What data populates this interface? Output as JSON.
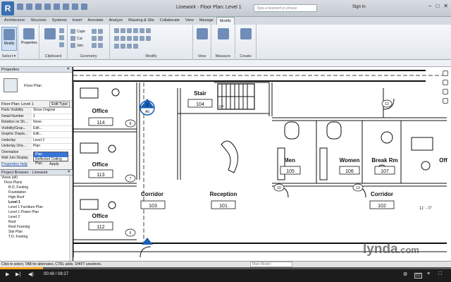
{
  "titlebar": {
    "app_icon": "R",
    "title": "Linework - Floor Plan: Level 1",
    "search_placeholder": "Type a keyword or phrase",
    "signin": "Sign In"
  },
  "tabs": [
    "Architecture",
    "Structure",
    "Systems",
    "Insert",
    "Annotate",
    "Analyze",
    "Massing & Site",
    "Collaborate",
    "View",
    "Manage",
    "Modify"
  ],
  "ribbon": {
    "modify_label": "Modify",
    "groups": [
      "Select ▾",
      "Properties",
      "Clipboard",
      "Geometry",
      "Modify",
      "View",
      "Measure",
      "Create"
    ],
    "geometry_items": [
      "Cope",
      "Cut",
      "Join"
    ],
    "properties_label": "Properties"
  },
  "properties": {
    "header": "Properties",
    "type_name": "Floor Plan",
    "instance": "Floor Plan: Level 1",
    "edit_type": "Edit Type",
    "rows": [
      {
        "k": "Parts Visibility",
        "v": "Show Original"
      },
      {
        "k": "Detail Number",
        "v": "1"
      },
      {
        "k": "Rotation on Sh...",
        "v": "None"
      },
      {
        "k": "Visibility/Grap...",
        "v": "Edit..."
      },
      {
        "k": "Graphic Displa...",
        "v": "Edit..."
      },
      {
        "k": "Underlay",
        "v": "Level 2"
      },
      {
        "k": "Underlay Orie...",
        "v": "Plan"
      },
      {
        "k": "Orientation",
        "v": ""
      },
      {
        "k": "Wall Join Display",
        "v": ""
      }
    ],
    "dropdown_options": [
      "Plan",
      "Reflected Ceiling Plan"
    ],
    "dropdown_selected": "Plan",
    "help": "Properties help",
    "apply": "Apply"
  },
  "browser": {
    "header": "Project Browser - Linework",
    "items": [
      "Views (all)",
      "Floor Plans",
      "B.O. Footing",
      "Foundation",
      "High Roof",
      "Level 1",
      "Level 1 Furniture Plan",
      "Level 1 Power Plan",
      "Level 2",
      "Roof",
      "Roof Framing",
      "Site Plan",
      "T.O. Footing"
    ]
  },
  "plan": {
    "rooms": [
      {
        "name": "Office",
        "num": "114"
      },
      {
        "name": "Office",
        "num": "113"
      },
      {
        "name": "Office",
        "num": "112"
      },
      {
        "name": "Stair",
        "num": "104"
      },
      {
        "name": "Men",
        "num": "105"
      },
      {
        "name": "Women",
        "num": "106"
      },
      {
        "name": "Break Rm",
        "num": "107"
      },
      {
        "name": "Off",
        "num": ""
      },
      {
        "name": "Corridor",
        "num": "103"
      },
      {
        "name": "Reception",
        "num": "101"
      },
      {
        "name": "Corridor",
        "num": "102"
      }
    ],
    "section_num": "3",
    "section_sheet": "A6",
    "doors": [
      "8",
      "7",
      "6",
      "12",
      "10",
      "13"
    ],
    "dim_text": "11' - 0\"",
    "up_label": "UP"
  },
  "status": {
    "text": "Click to select, TAB for alternates, CTRL adds, SHIFT unselects.",
    "model": "Main Model"
  },
  "player": {
    "time": "00:48 / 08:27",
    "progress": 0.095,
    "cc": "CC"
  },
  "watermark": {
    "brand": "lynda",
    "suffix": ".com"
  }
}
